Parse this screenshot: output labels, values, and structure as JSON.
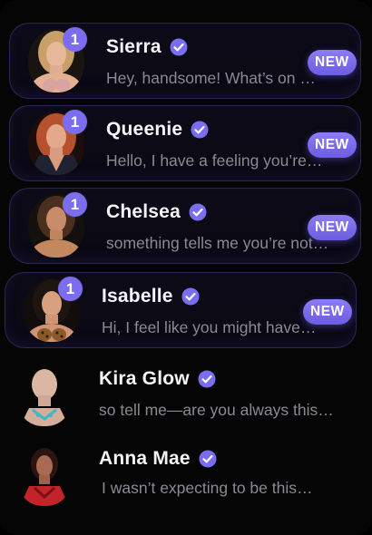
{
  "colors": {
    "accent": "#7b6df0",
    "background": "#050506",
    "name": "#f4f4f6",
    "preview": "#8a8a92"
  },
  "chats": [
    {
      "name": "Sierra",
      "preview": "Hey, handsome! What’s on …",
      "unread_count": "1",
      "tag": "NEW",
      "verified_icon": "verified-check-icon"
    },
    {
      "name": "Queenie",
      "preview": "Hello, I have a feeling you’re…",
      "unread_count": "1",
      "tag": "NEW",
      "verified_icon": "verified-check-icon"
    },
    {
      "name": "Chelsea",
      "preview": "something tells me you’re not…",
      "unread_count": "1",
      "tag": "NEW",
      "verified_icon": "verified-check-icon"
    },
    {
      "name": "Isabelle",
      "preview": "Hi, I feel like you might have…",
      "unread_count": "1",
      "tag": "NEW",
      "verified_icon": "verified-check-icon"
    },
    {
      "name": "Kira Glow",
      "preview": "so tell me—are you always this…",
      "verified_icon": "verified-check-icon"
    },
    {
      "name": "Anna Mae",
      "preview": "I wasn’t expecting to be this…",
      "verified_icon": "verified-check-icon"
    }
  ]
}
